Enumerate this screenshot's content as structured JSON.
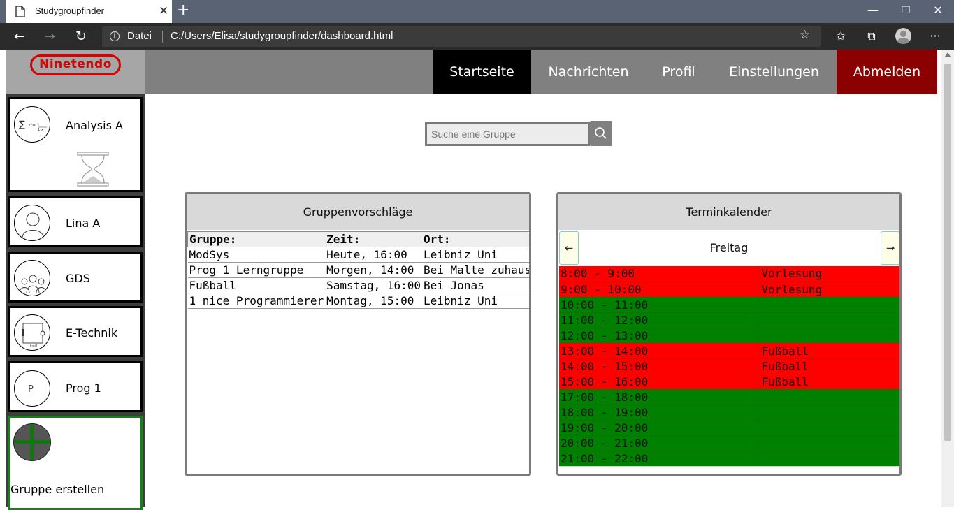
{
  "browser": {
    "tab_title": "Studygroupfinder",
    "tab_close": "✕",
    "new_tab": "+",
    "url_label": "Datei",
    "url": "C:/Users/Elisa/studygroupfinder/dashboard.html",
    "window_controls": {
      "minimize": "—",
      "maximize": "❐",
      "close": "✕"
    },
    "nav": {
      "back": "←",
      "forward": "→",
      "refresh": "↻"
    },
    "toolbar": {
      "favorite": "☆",
      "favorites_list": "✩",
      "collections": "⧉",
      "more": "···"
    }
  },
  "app": {
    "logo_text": "Ninetendo",
    "nav": [
      {
        "label": "Startseite",
        "active": true
      },
      {
        "label": "Nachrichten",
        "active": false
      },
      {
        "label": "Profil",
        "active": false
      },
      {
        "label": "Einstellungen",
        "active": false
      },
      {
        "label": "Abmelden",
        "active": false
      }
    ]
  },
  "sidebar": {
    "groups": [
      {
        "name": "Analysis A",
        "icon": "math-formula-icon"
      },
      {
        "name": "Lina A",
        "icon": "person-icon"
      },
      {
        "name": "GDS",
        "icon": "people-group-icon"
      },
      {
        "name": "E-Technik",
        "icon": "circuit-icon"
      },
      {
        "name": "Prog 1",
        "icon": "letter-p-icon"
      }
    ],
    "loading_icon": "hourglass-icon",
    "create_label": "Gruppe erstellen"
  },
  "search": {
    "placeholder": "Suche eine Gruppe",
    "button_icon": "search-icon"
  },
  "suggestions": {
    "title": "Gruppenvorschläge",
    "headers": [
      "Gruppe:",
      "Zeit:",
      "Ort:"
    ],
    "rows": [
      [
        "ModSys",
        "Heute, 16:00",
        "Leibniz Uni"
      ],
      [
        "Prog 1 Lerngruppe",
        "Morgen, 14:00",
        "Bei Malte zuhause"
      ],
      [
        "Fußball",
        "Samstag, 16:00",
        "Bei Jonas"
      ],
      [
        "1 nice Programmierer",
        "Montag, 15:00",
        "Leibniz Uni"
      ]
    ]
  },
  "calendar": {
    "title": "Terminkalender",
    "day": "Freitag",
    "prev": "←",
    "next": "→",
    "colors": {
      "busy": "#ff0000",
      "free": "#008000"
    },
    "slots": [
      {
        "time": "8:00 - 9:00",
        "event": "Vorlesung",
        "busy": true
      },
      {
        "time": "9:00 - 10:00",
        "event": "Vorlesung",
        "busy": true
      },
      {
        "time": "10:00 - 11:00",
        "event": "",
        "busy": false
      },
      {
        "time": "11:00 - 12:00",
        "event": "",
        "busy": false
      },
      {
        "time": "12:00 - 13:00",
        "event": "",
        "busy": false
      },
      {
        "time": "13:00 - 14:00",
        "event": "Fußball",
        "busy": true
      },
      {
        "time": "14:00 - 15:00",
        "event": "Fußball",
        "busy": true
      },
      {
        "time": "15:00 - 16:00",
        "event": "Fußball",
        "busy": true
      },
      {
        "time": "17:00 - 18:00",
        "event": "",
        "busy": false
      },
      {
        "time": "18:00 - 19:00",
        "event": "",
        "busy": false
      },
      {
        "time": "19:00 - 20:00",
        "event": "",
        "busy": false
      },
      {
        "time": "20:00 - 21:00",
        "event": "",
        "busy": false
      },
      {
        "time": "21:00 - 22:00",
        "event": "",
        "busy": false
      }
    ]
  }
}
